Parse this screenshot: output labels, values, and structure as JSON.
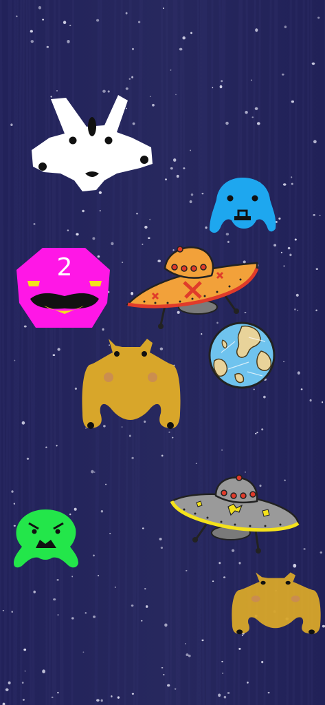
{
  "scene": {
    "background_color": "#24245a",
    "star_color": "#dcdcee"
  },
  "sprites": [
    {
      "id": "white-alien",
      "icon": "horned-alien-face-icon",
      "color": "#ffffff"
    },
    {
      "id": "blue-alien",
      "icon": "jellyfish-alien-icon",
      "color": "#1ea7ef"
    },
    {
      "id": "magenta-alien",
      "icon": "heptagon-alien-icon",
      "color": "#ff17e6",
      "label": "2"
    },
    {
      "id": "orange-ufo",
      "icon": "flying-saucer-icon",
      "color": "#f2a13a"
    },
    {
      "id": "planet",
      "icon": "earth-planet-icon",
      "color": "#6fc3ee"
    },
    {
      "id": "gold-alien",
      "icon": "crab-alien-icon",
      "color": "#d8a62a"
    },
    {
      "id": "grey-ufo",
      "icon": "flying-saucer-icon",
      "color": "#9a9a9a"
    },
    {
      "id": "green-alien",
      "icon": "frog-alien-icon",
      "color": "#23e64a"
    },
    {
      "id": "gold-alien-small",
      "icon": "crab-alien-icon",
      "color": "#d8a62a"
    }
  ]
}
